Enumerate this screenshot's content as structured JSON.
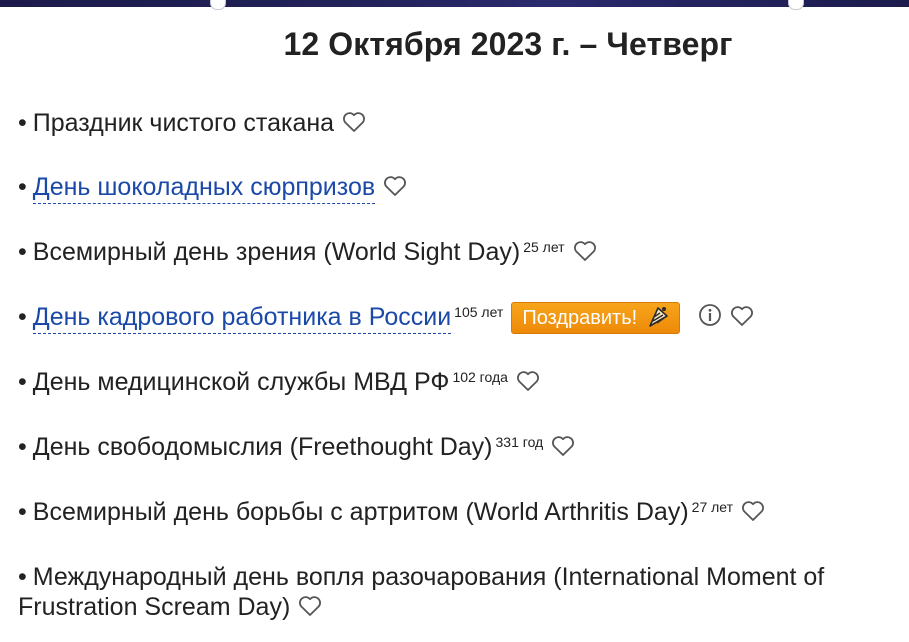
{
  "page": {
    "title": "12 Октября 2023 г. – Четверг"
  },
  "items": [
    {
      "name": "Праздник чистого стакана",
      "years": "",
      "link": false
    },
    {
      "name": "День шоколадных сюрпризов",
      "years": "",
      "link": true
    },
    {
      "name": "Всемирный день зрения (World Sight Day)",
      "years": "25 лет",
      "link": false
    },
    {
      "name": "День кадрового работника в России",
      "years": "105 лет",
      "link": true,
      "button": "Поздравить!"
    },
    {
      "name": "День медицинской службы МВД РФ",
      "years": "102 года",
      "link": false
    },
    {
      "name": "День свободомыслия (Freethought Day)",
      "years": "331 год",
      "link": false
    },
    {
      "name": "Всемирный день борьбы с артритом (World Arthritis Day)",
      "years": "27 лет",
      "link": false
    },
    {
      "name": "Международный день вопля разочарования (International Moment of Frustration Scream Day)",
      "years": "",
      "link": false
    }
  ],
  "bullet": "•",
  "icons": {
    "favorite": "heart-outline-icon",
    "info": "info-circle-icon",
    "gift": "gift-icon"
  },
  "colors": {
    "link": "#1a49a8",
    "button": "#f29611",
    "text": "#222222"
  }
}
